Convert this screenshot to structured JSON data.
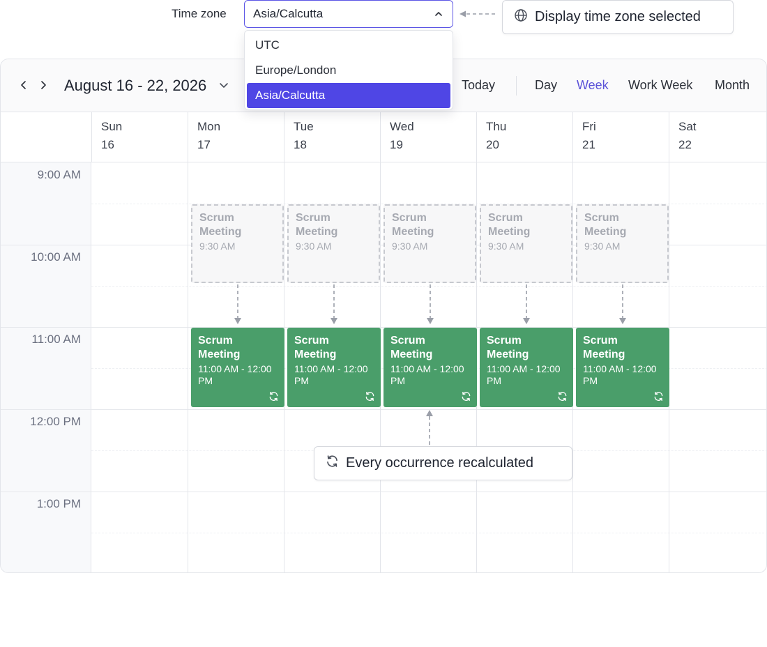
{
  "timezone": {
    "label": "Time zone",
    "selected": "Asia/Calcutta",
    "options": [
      "UTC",
      "Europe/London",
      "Asia/Calcutta"
    ]
  },
  "callouts": {
    "timezone_selected": "Display time zone selected",
    "recalculated": "Every occurrence recalculated"
  },
  "toolbar": {
    "range": "August 16 - 22, 2026",
    "today": "Today",
    "views": [
      "Day",
      "Week",
      "Work Week",
      "Month"
    ],
    "active_view": "Week"
  },
  "days": [
    {
      "name": "Sun",
      "num": "16"
    },
    {
      "name": "Mon",
      "num": "17"
    },
    {
      "name": "Tue",
      "num": "18"
    },
    {
      "name": "Wed",
      "num": "19"
    },
    {
      "name": "Thu",
      "num": "20"
    },
    {
      "name": "Fri",
      "num": "21"
    },
    {
      "name": "Sat",
      "num": "22"
    }
  ],
  "times": [
    "9:00 AM",
    "10:00 AM",
    "11:00 AM",
    "12:00 PM",
    "1:00 PM"
  ],
  "ghost_event": {
    "title": "Scrum Meeting",
    "time": "9:30 AM"
  },
  "event": {
    "title": "Scrum Meeting",
    "time": "11:00 AM - 12:00 PM"
  },
  "colors": {
    "accent": "#4f46e5",
    "active_view": "#5b52d8",
    "event": "#4a9e6a",
    "ghost_border": "#c7c9cf"
  },
  "icons": {
    "globe": "globe-icon",
    "recurrence": "recurrence-icon",
    "prev": "chevron-left-icon",
    "next": "chevron-right-icon"
  }
}
